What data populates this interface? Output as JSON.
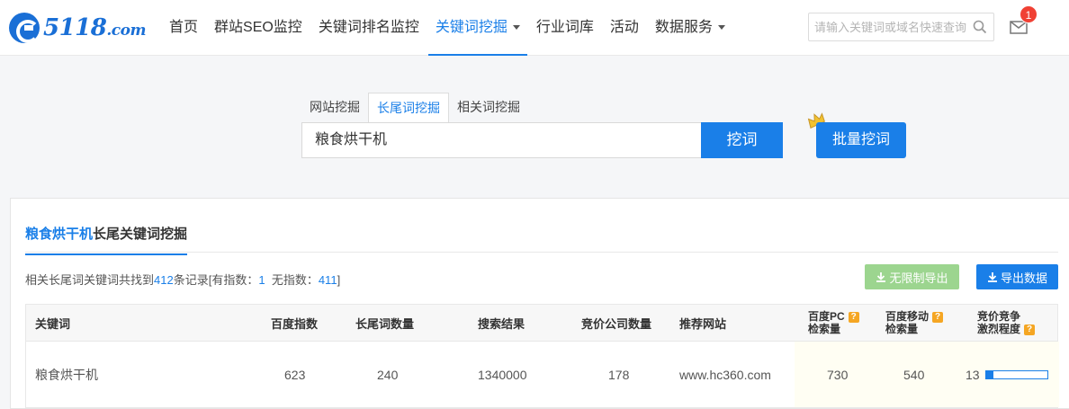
{
  "header": {
    "logo_main": "5118",
    "logo_suffix": ".com",
    "nav": [
      {
        "label": "首页",
        "active": false,
        "dropdown": false
      },
      {
        "label": "群站SEO监控",
        "active": false,
        "dropdown": false
      },
      {
        "label": "关键词排名监控",
        "active": false,
        "dropdown": false
      },
      {
        "label": "关键词挖掘",
        "active": true,
        "dropdown": true
      },
      {
        "label": "行业词库",
        "active": false,
        "dropdown": false
      },
      {
        "label": "活动",
        "active": false,
        "dropdown": false
      },
      {
        "label": "数据服务",
        "active": false,
        "dropdown": true
      }
    ],
    "search_placeholder": "请输入关键词或域名快速查询",
    "notification_count": "1"
  },
  "search": {
    "tabs": [
      {
        "label": "网站挖掘",
        "active": false
      },
      {
        "label": "长尾词挖掘",
        "active": true
      },
      {
        "label": "相关词挖掘",
        "active": false
      }
    ],
    "keyword": "粮食烘干机",
    "dig_label": "挖词",
    "batch_label": "批量挖词"
  },
  "results": {
    "tab_keyword": "粮食烘干机",
    "tab_suffix": "长尾关键词挖掘",
    "summary_prefix": "相关长尾词关键词共找到",
    "total": "412",
    "summary_mid": "条记录[有指数：",
    "with_index": "1",
    "summary_mid2": "无指数：",
    "without_index": "411",
    "summary_end": "]",
    "export_unlimited_label": "无限制导出",
    "export_label": "导出数据",
    "columns": {
      "keyword": "关键词",
      "baidu_index": "百度指数",
      "longtail_count": "长尾词数量",
      "search_results": "搜索结果",
      "bidding_companies": "竞价公司数量",
      "recommended_site": "推荐网站",
      "pc_volume_1": "百度PC",
      "pc_volume_2": "检索量",
      "mobile_volume_1": "百度移动",
      "mobile_volume_2": "检索量",
      "competition_1": "竞价竞争",
      "competition_2": "激烈程度"
    },
    "rows": [
      {
        "keyword": "粮食烘干机",
        "baidu_index": "623",
        "longtail_count": "240",
        "search_results": "1340000",
        "bidding_companies": "178",
        "recommended_site": "www.hc360.com",
        "pc_volume": "730",
        "mobile_volume": "540",
        "competition": "13",
        "competition_percent": 13
      }
    ]
  },
  "colors": {
    "accent": "#1a7fe8",
    "export_unlimited": "#9cd58f",
    "badge": "#f04134",
    "help": "#f5a623"
  },
  "icons": {
    "logo": "5118-logo-icon",
    "nav_caret": "chevron-down-icon",
    "search": "search-icon",
    "mail": "mail-icon",
    "vip": "crown-icon",
    "download": "download-icon",
    "help": "question-icon"
  }
}
